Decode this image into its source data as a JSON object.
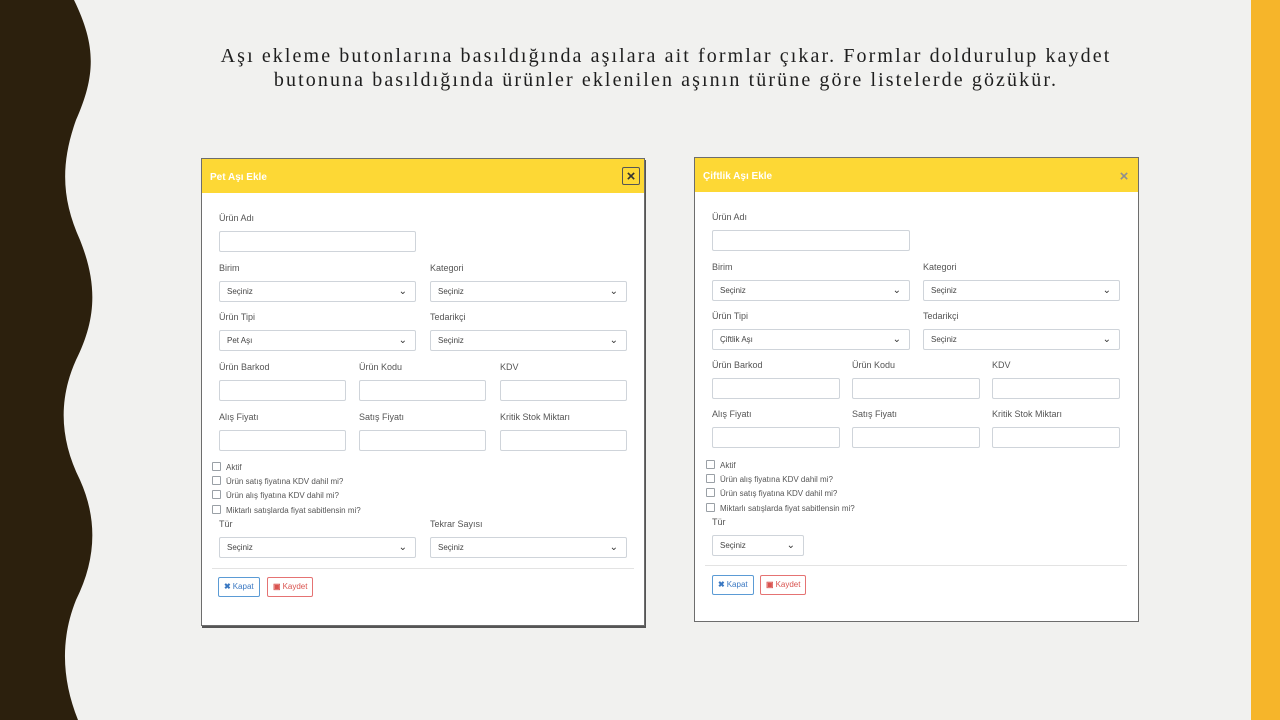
{
  "slide": {
    "heading_line1": "Aşı ekleme butonlarına basıldığında aşılara ait formlar çıkar. Formlar doldurulup kaydet",
    "heading_line2": "butonuna basıldığında ürünler eklenilen aşının türüne göre listelerde gözükür.",
    "colors": {
      "accent": "#fdd835",
      "side_bar": "#f6b52a",
      "wave": "#2c200d"
    }
  },
  "pet_form": {
    "title": "Pet Aşı Ekle",
    "close": "×",
    "urun_adi": "Ürün Adı",
    "birim": "Birim",
    "birim_value": "Seçiniz",
    "kategori": "Kategori",
    "kategori_value": "Seçiniz",
    "urun_tipi": "Ürün Tipi",
    "urun_tipi_value": "Pet Aşı",
    "tedarikci": "Tedarikçi",
    "tedarikci_value": "Seçiniz",
    "urun_barkod": "Ürün Barkod",
    "urun_kodu": "Ürün Kodu",
    "kdv": "KDV",
    "alis_fiyati": "Alış Fiyatı",
    "satis_fiyati": "Satış Fiyatı",
    "kritik_stok": "Kritik Stok Miktarı",
    "chk_aktif": "Aktif",
    "chk_satis_kdv": "Ürün satış fiyatına KDV dahil mi?",
    "chk_alis_kdv": "Ürün alış fiyatına KDV dahil mi?",
    "chk_miktarli": "Miktarlı satışlarda fiyat sabitlensin mi?",
    "tur": "Tür",
    "tur_value": "Seçiniz",
    "tekrar_sayisi": "Tekrar Sayısı",
    "tekrar_value": "Seçiniz",
    "kapat": "Kapat",
    "kaydet": "Kaydet"
  },
  "ciftlik_form": {
    "title": "Çiftlik Aşı Ekle",
    "close": "×",
    "urun_adi": "Ürün Adı",
    "birim": "Birim",
    "birim_value": "Seçiniz",
    "kategori": "Kategori",
    "kategori_value": "Seçiniz",
    "urun_tipi": "Ürün Tipi",
    "urun_tipi_value": "Çiftlik Aşı",
    "tedarikci": "Tedarikçi",
    "tedarikci_value": "Seçiniz",
    "urun_barkod": "Ürün Barkod",
    "urun_kodu": "Ürün Kodu",
    "kdv": "KDV",
    "alis_fiyati": "Alış Fiyatı",
    "satis_fiyati": "Satış Fiyatı",
    "kritik_stok": "Kritik Stok Miktarı",
    "chk_aktif": "Aktif",
    "chk_alis_kdv": "Ürün alış fiyatına KDV dahil mi?",
    "chk_satis_kdv": "Ürün satış fiyatına KDV dahil mi?",
    "chk_miktarli": "Miktarlı satışlarda fiyat sabitlensin mi?",
    "tur": "Tür",
    "tur_value": "Seçiniz",
    "kapat": "Kapat",
    "kaydet": "Kaydet"
  },
  "icons": {
    "chevron": "chevron-down-icon",
    "close": "close-icon",
    "kapat": "x-icon",
    "kaydet": "floppy-disk-icon"
  }
}
